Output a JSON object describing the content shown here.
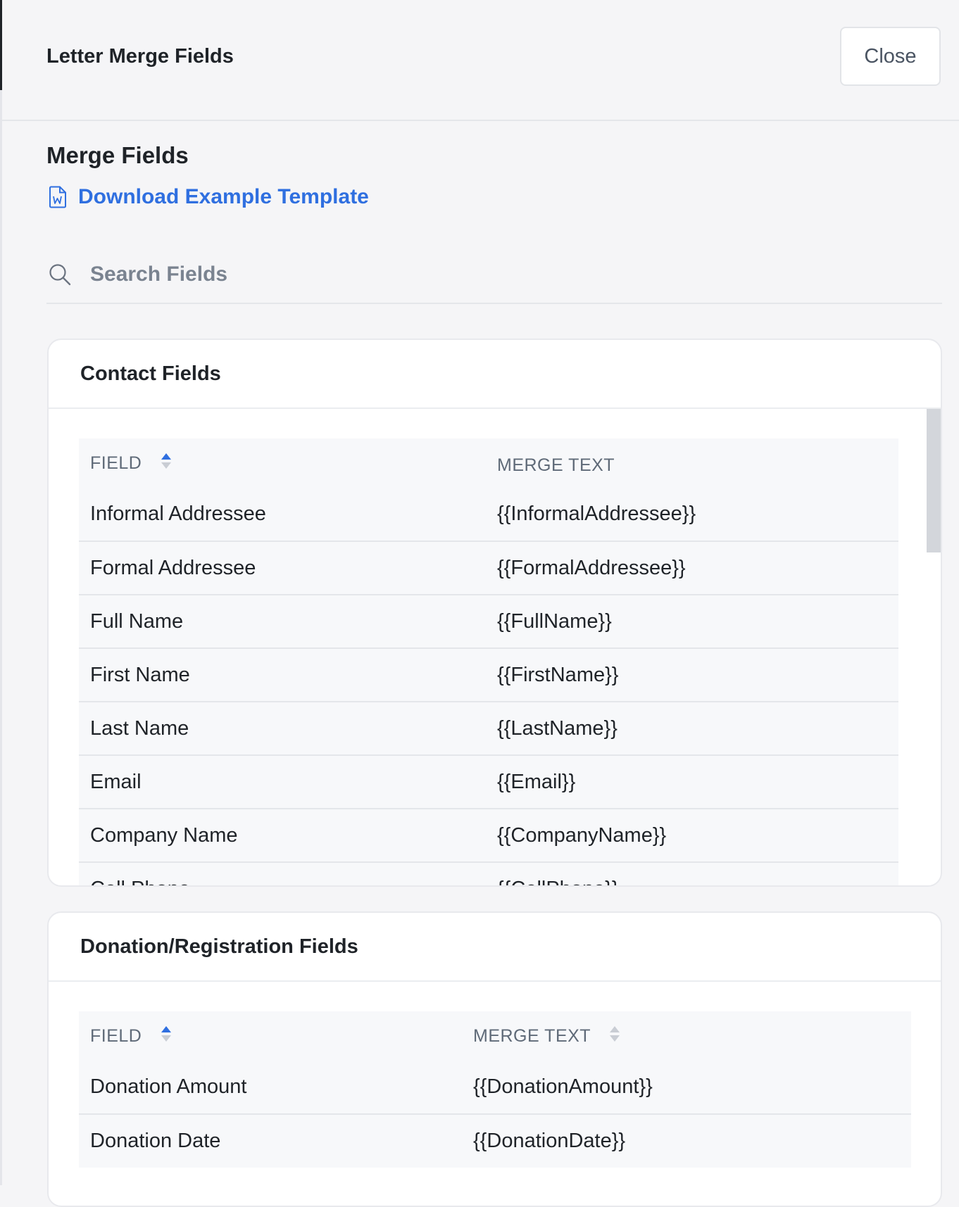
{
  "header": {
    "title": "Letter Merge Fields",
    "close_label": "Close"
  },
  "main": {
    "title": "Merge Fields",
    "download_link": "Download Example Template",
    "search": {
      "placeholder": "Search Fields",
      "value": ""
    }
  },
  "contact_fields": {
    "title": "Contact Fields",
    "columns": [
      "FIELD",
      "MERGE TEXT"
    ],
    "rows": [
      {
        "field": "Informal Addressee",
        "merge": "{{InformalAddressee}}"
      },
      {
        "field": "Formal Addressee",
        "merge": "{{FormalAddressee}}"
      },
      {
        "field": "Full Name",
        "merge": "{{FullName}}"
      },
      {
        "field": "First Name",
        "merge": "{{FirstName}}"
      },
      {
        "field": "Last Name",
        "merge": "{{LastName}}"
      },
      {
        "field": "Email",
        "merge": "{{Email}}"
      },
      {
        "field": "Company Name",
        "merge": "{{CompanyName}}"
      },
      {
        "field": "Cell Phone",
        "merge": "{{CellPhone}}"
      }
    ]
  },
  "donation_fields": {
    "title": "Donation/Registration Fields",
    "columns": [
      "FIELD",
      "MERGE TEXT"
    ],
    "rows": [
      {
        "field": "Donation Amount",
        "merge": "{{DonationAmount}}"
      },
      {
        "field": "Donation Date",
        "merge": "{{DonationDate}}"
      }
    ]
  },
  "colors": {
    "accent": "#2f6fe0",
    "sort_inactive": "#c9cdd4"
  },
  "icons": [
    "word-document-icon",
    "search-icon",
    "sort-icon"
  ]
}
